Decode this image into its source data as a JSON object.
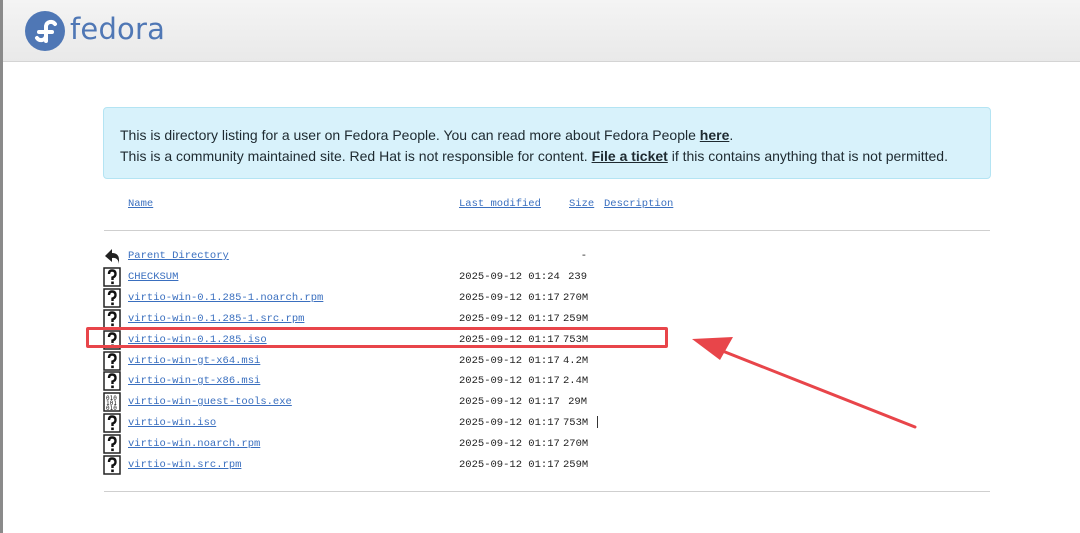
{
  "brand": {
    "name": "fedora",
    "color": "#4f77b5"
  },
  "notice": {
    "line1_text": "This is directory listing for a user on Fedora People. You can read more about Fedora People ",
    "line1_link": "here",
    "line1_end": ".",
    "line2_text": "This is a community maintained site. Red Hat is not responsible for content. ",
    "line2_link": "File a ticket",
    "line2_end": " if this contains anything that is not permitted."
  },
  "table": {
    "headers": {
      "name": "Name",
      "last_modified": "Last modified",
      "size": "Size",
      "description": "Description"
    },
    "rows": [
      {
        "name": "Parent Directory",
        "date": "",
        "size": "-",
        "icon": "back-icon"
      },
      {
        "name": "CHECKSUM",
        "date": "2025-09-12 01:24",
        "size": "239",
        "icon": "unknown-file-icon"
      },
      {
        "name": "virtio-win-0.1.285-1.noarch.rpm",
        "date": "2025-09-12 01:17",
        "size": "270M",
        "icon": "unknown-file-icon"
      },
      {
        "name": "virtio-win-0.1.285-1.src.rpm",
        "date": "2025-09-12 01:17",
        "size": "259M",
        "icon": "unknown-file-icon"
      },
      {
        "name": "virtio-win-0.1.285.iso",
        "date": "2025-09-12 01:17",
        "size": "753M",
        "icon": "unknown-file-icon"
      },
      {
        "name": "virtio-win-gt-x64.msi",
        "date": "2025-09-12 01:17",
        "size": "4.2M",
        "icon": "unknown-file-icon"
      },
      {
        "name": "virtio-win-gt-x86.msi",
        "date": "2025-09-12 01:17",
        "size": "2.4M",
        "icon": "unknown-file-icon"
      },
      {
        "name": "virtio-win-guest-tools.exe",
        "date": "2025-09-12 01:17",
        "size": "29M",
        "icon": "binary-file-icon"
      },
      {
        "name": "virtio-win.iso",
        "date": "2025-09-12 01:17",
        "size": "753M",
        "icon": "unknown-file-icon"
      },
      {
        "name": "virtio-win.noarch.rpm",
        "date": "2025-09-12 01:17",
        "size": "270M",
        "icon": "unknown-file-icon"
      },
      {
        "name": "virtio-win.src.rpm",
        "date": "2025-09-12 01:17",
        "size": "259M",
        "icon": "unknown-file-icon"
      }
    ]
  },
  "annotation": {
    "color": "#e8454a",
    "highlighted_row": "virtio-win-0.1.285.iso"
  }
}
